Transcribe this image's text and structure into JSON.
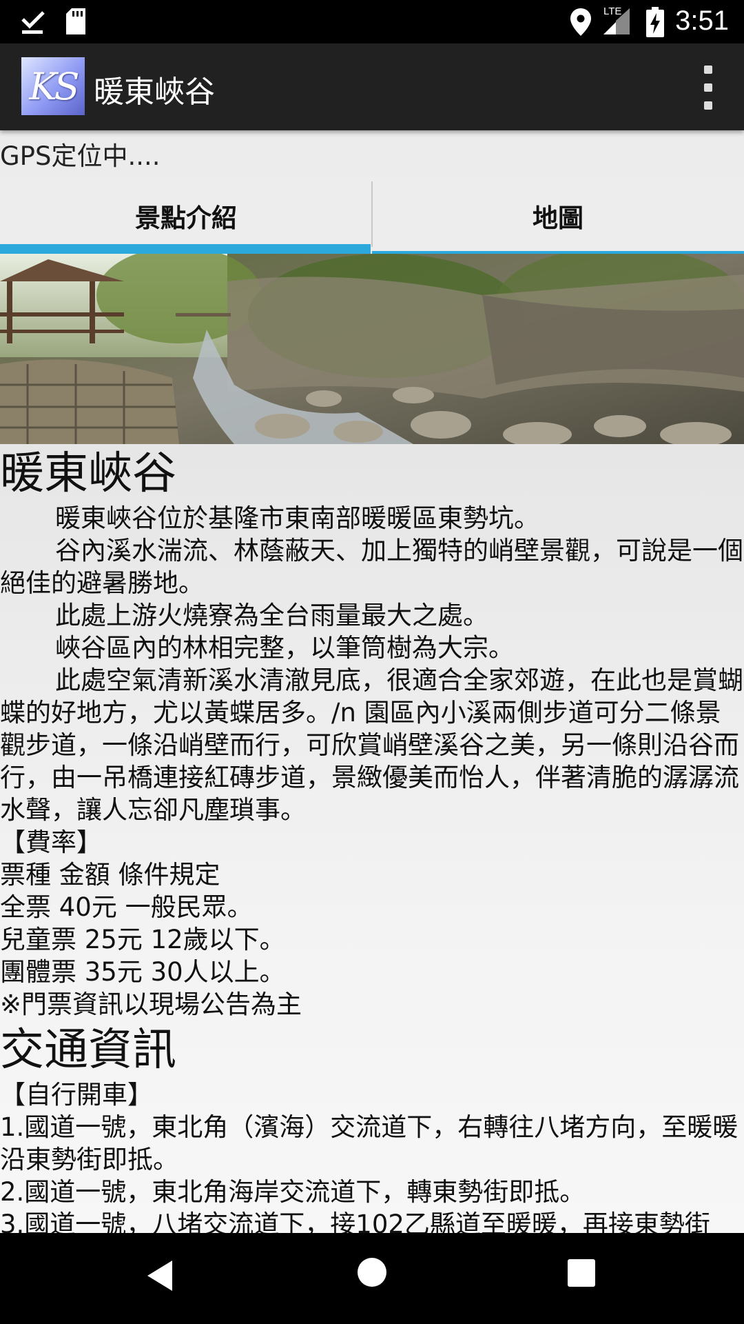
{
  "status_bar": {
    "time": "3:51",
    "network": "LTE"
  },
  "app_bar": {
    "logo_text": "KS",
    "title": "暖東峽谷"
  },
  "gps_status": "GPS定位中....",
  "tabs": [
    {
      "label": "景點介紹",
      "selected": true
    },
    {
      "label": "地圖",
      "selected": false
    }
  ],
  "accent_color": "#2ba9dc",
  "content": {
    "title": "暖東峽谷",
    "intro": [
      "暖東峽谷位於基隆市東南部暖暖區東勢坑。",
      "谷內溪水湍流、林蔭蔽天、加上獨特的峭壁景觀，可說是一個絕佳的避暑勝地。",
      "此處上游火燒寮為全台雨量最大之處。",
      "峽谷區內的林相完整，以筆筒樹為大宗。",
      "此處空氣清新溪水清澈見底，很適合全家郊遊，在此也是賞蝴蝶的好地方，尤以黃蝶居多。/n 園區內小溪兩側步道可分二條景觀步道，一條沿峭壁而行，可欣賞峭壁溪谷之美，另一條則沿谷而行，由一吊橋連接紅磚步道，景緻優美而怡人，伴著清脆的潺潺流水聲，讓人忘卻凡塵瑣事。"
    ],
    "fee_heading": "【費率】",
    "fee_lines": [
      "票種 金額 條件規定",
      "全票 40元 一般民眾。",
      "兒童票 25元 12歲以下。",
      "團體票 35元 30人以上。",
      "※門票資訊以現場公告為主"
    ],
    "transport_title": "交通資訊",
    "drive_heading": "【自行開車】",
    "drive_lines": [
      "1.國道一號，東北角（濱海）交流道下，右轉往八堵方向，至暖暖沿東勢街即抵。",
      "2.國道一號，東北角海岸交流道下，轉東勢街即抵。",
      "3.國道一號，八堵交流道下，接102乙縣道至暖暖，再接東勢街"
    ]
  }
}
